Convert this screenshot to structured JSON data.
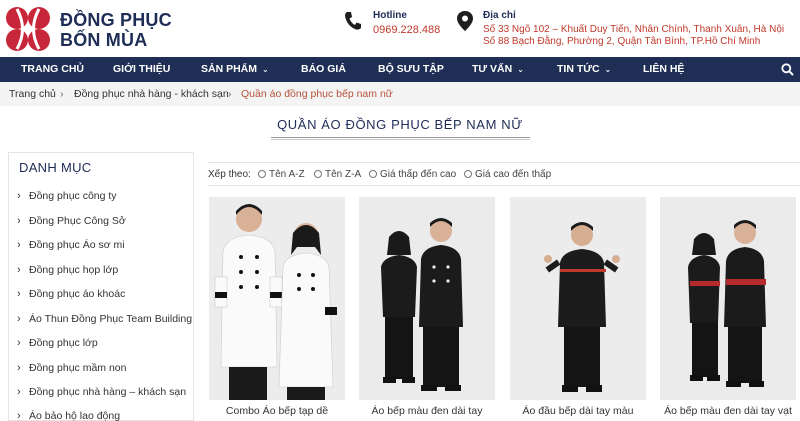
{
  "brand": {
    "line1": "ĐỒNG PHỤC",
    "line2": "BỐN MÙA",
    "color": "#1f2d56",
    "logo_color": "#c8263a"
  },
  "contact": {
    "hotline_label": "Hotline",
    "hotline_value": "0969.228.488",
    "address_label": "Địa chỉ",
    "address_line1": "Số 33 Ngõ 102 – Khuất Duy Tiến, Nhân Chính, Thanh Xuân, Hà Nội",
    "address_line2": "Số 88 Bạch Đằng, Phường 2, Quận Tân Bình, TP.Hồ Chí Minh"
  },
  "nav": {
    "items": [
      {
        "label": "TRANG CHỦ"
      },
      {
        "label": "GIỚI THIỆU"
      },
      {
        "label": "SẢN PHẨM",
        "dropdown": true
      },
      {
        "label": "BÁO GIÁ"
      },
      {
        "label": "BỘ SƯU TẬP"
      },
      {
        "label": "TƯ VẤN",
        "dropdown": true
      },
      {
        "label": "TIN TỨC",
        "dropdown": true
      },
      {
        "label": "LIÊN HỆ"
      }
    ],
    "bg_color": "#1e2e55"
  },
  "breadcrumb": {
    "items": [
      "Trang chủ",
      "Đồng phục nhà hàng - khách sạn",
      "Quần áo đồng phục bếp nam nữ"
    ],
    "separator": "›"
  },
  "page_title": "QUẦN ÁO ĐỒNG PHỤC BẾP NAM NỮ",
  "sidebar": {
    "heading": "DANH MỤC",
    "items": [
      "Đồng phục công ty",
      "Đồng Phục Công Sở",
      "Đồng phục Áo sơ mi",
      "Đồng phục họp lớp",
      "Đồng phục áo khoác",
      "Áo Thun Đồng Phục Team Building",
      "Đồng phục lớp",
      "Đồng phục mầm non",
      "Đồng phục nhà hàng – khách sạn",
      "Áo bảo hộ lao động"
    ]
  },
  "sort": {
    "label": "Xếp theo:",
    "options": [
      "Tên A-Z",
      "Tên Z-A",
      "Giá thấp đến cao",
      "Giá cao đến thấp"
    ]
  },
  "products": [
    {
      "name": "Combo Áo bếp tạp dề"
    },
    {
      "name": "Áo bếp màu đen dài tay"
    },
    {
      "name": "Áo đầu bếp dài tay màu"
    },
    {
      "name": "Áo bếp màu đen dài tay vạt"
    }
  ],
  "colors": {
    "accent_red": "#c0392b",
    "crumb_current": "#b5523b"
  }
}
